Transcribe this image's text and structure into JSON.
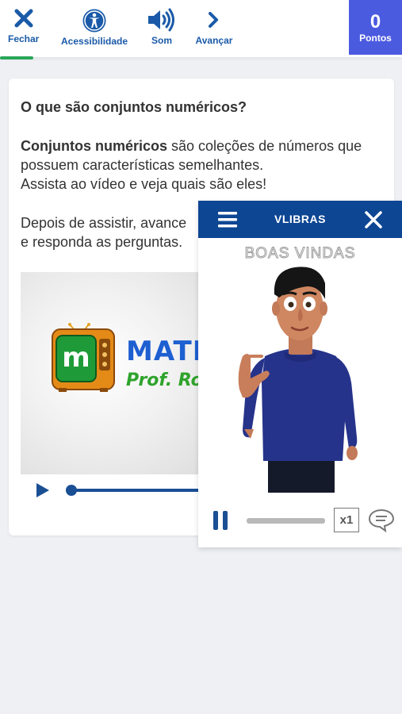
{
  "topbar": {
    "close_label": "Fechar",
    "accessibility_label": "Acessibilidade",
    "sound_label": "Som",
    "next_label": "Avançar",
    "points_value": "0",
    "points_label": "Pontos",
    "accent_color": "#1a5aa8",
    "points_bg": "#4b5be0"
  },
  "card": {
    "title": "O que são conjuntos numéricos?",
    "intro_bold": "Conjuntos numéricos",
    "intro_rest": " são coleções de números que possuem características semelhantes.",
    "intro_line3": "Assista ao vídeo e veja quais são eles!",
    "after_line1": "Depois de assistir, avance",
    "after_line2": "e responda as perguntas."
  },
  "video": {
    "logo_letter": "m",
    "brand_text": "MATE",
    "brand_sub": "Prof. Ro"
  },
  "vlibras": {
    "title": "VLIBRAS",
    "caption": "BOAS VINDAS",
    "speed_label": "x1",
    "header_color": "#0d4693"
  }
}
